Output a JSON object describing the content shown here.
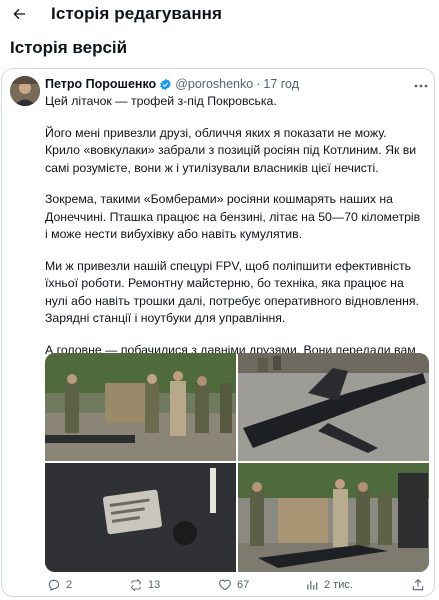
{
  "topbar": {
    "title": "Історія редагування",
    "back_icon": "arrow-left-icon"
  },
  "section": {
    "title": "Історія версій"
  },
  "tweet": {
    "author_name": "Петро Порошенко",
    "handle": "@poroshenko",
    "separator": "·",
    "time": "17 год",
    "paragraphs": [
      "Цей літачок — трофей з-під Покровська.",
      "Його мені привезли друзі, обличчя яких я показати не можу. Крило «вовкулаки» забрали з позицій росіян під Котлиним. Як ви самі розумієте, вони ж і утилізували власників цієї нечисті.",
      "Зокрема, такими «Бомберами» росіяни кошмарять наших на Донеччині. Пташка працює на бензині, літає на 50—70 кілометрів і може нести вибухівку або навіть кумулятив.",
      "Ми ж привезли нашій спецурі FPV, щоб поліпшити ефективність їхньої роботи. Ремонтну майстерню, бо техніка, яка працює на нулі або навіть трошки далі, потребує оперативного відновлення. Зарядні станції і ноутбуки для управління.",
      "А головне — побачилися з давніми друзями. Вони передали вам вітання зі Сходу😉"
    ],
    "actions": {
      "replies": "2",
      "reposts": "13",
      "likes": "67",
      "views": "2 тис."
    }
  },
  "colors": {
    "text": "#0f1419",
    "muted": "#536471",
    "border": "#cfd9de",
    "verified": "#1d9bf0"
  }
}
